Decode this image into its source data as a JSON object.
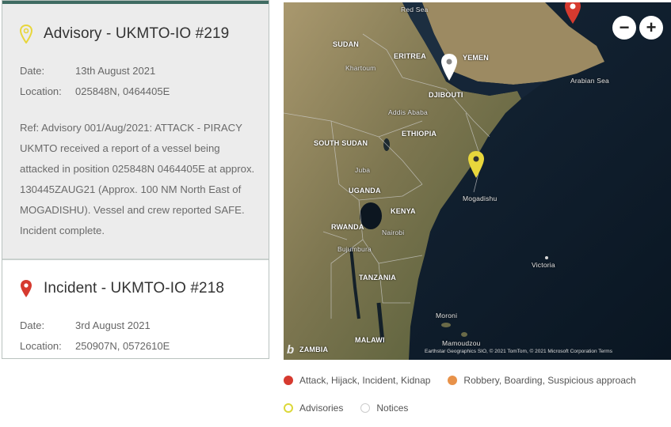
{
  "incidents": [
    {
      "title": "Advisory - UKMTO-IO #219",
      "pin_color": "#e8d63c",
      "date_label": "Date:",
      "date": "13th August 2021",
      "location_label": "Location:",
      "location": "025848N, 0464405E",
      "description": "Ref: Advisory 001/Aug/2021: ATTACK - PIRACY UKMTO received a report of a vessel being attacked in position 025848N 0464405E at approx. 130445ZAUG21 (Approx. 100 NM North East of MOGADISHU). Vessel and crew reported SAFE. Incident complete."
    },
    {
      "title": "Incident - UKMTO-IO #218",
      "pin_color": "#d63a2f",
      "date_label": "Date:",
      "date": "3rd August 2021",
      "location_label": "Location:",
      "location": "250907N, 0572610E"
    }
  ],
  "map": {
    "labels": {
      "red_sea": "Red Sea",
      "sudan": "SUDAN",
      "khartoum": "Khartoum",
      "eritrea": "ERITREA",
      "yemen": "YEMEN",
      "djibouti": "DJIBOUTI",
      "addis_ababa": "Addis Ababa",
      "ethiopia": "ETHIOPIA",
      "arabian_sea": "Arabian Sea",
      "south_sudan": "SOUTH SUDAN",
      "juba": "Juba",
      "uganda": "UGANDA",
      "kenya": "KENYA",
      "mogadishu": "Mogadishu",
      "rwanda": "RWANDA",
      "nairobi": "Nairobi",
      "bujumbura": "Bujumbura",
      "tanzania": "TANZANIA",
      "victoria": "Victoria",
      "moroni": "Moroni",
      "malawi": "MALAWI",
      "mamoudzou": "Mamoudzou",
      "zambia": "ZAMBIA"
    },
    "zoom_out": "−",
    "zoom_in": "+",
    "bing_logo": "b",
    "attribution": "Earthstar Geographics SIO, © 2021 TomTom, © 2021 Microsoft Corporation   Terms",
    "marker_colors": {
      "attack": "#d63a2f",
      "advisory": "#e8d63c",
      "notice": "#ffffff"
    }
  },
  "legend": {
    "items": [
      {
        "label": "Attack, Hijack, Incident, Kidnap",
        "color": "#d63a2f"
      },
      {
        "label": "Robbery, Boarding, Suspicious approach",
        "color": "#e8924a"
      },
      {
        "label": "Advisories",
        "color": "#dcd83a"
      },
      {
        "label": "Notices",
        "color": "#cccccc"
      }
    ]
  }
}
